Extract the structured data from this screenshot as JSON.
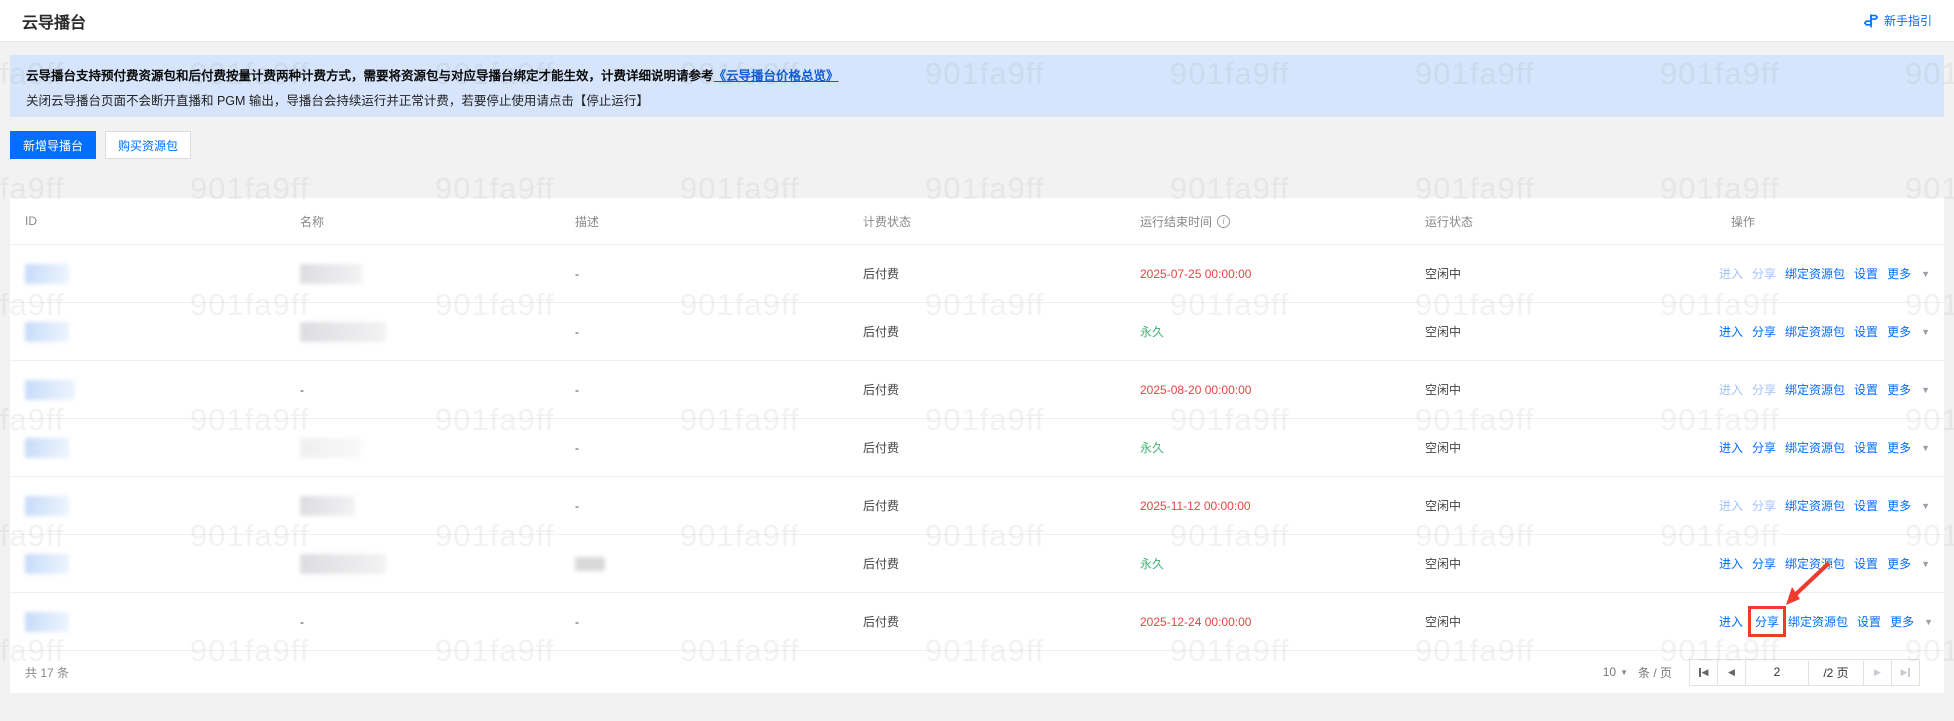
{
  "page": {
    "title": "云导播台"
  },
  "header": {
    "guide_label": "新手指引"
  },
  "banner": {
    "line1_prefix": "云导播台支持预付费资源包和后付费按量计费两种计费方式，需要将资源包与对应导播台绑定才能生效，计费详细说明请参考",
    "line1_link": "《云导播台价格总览》",
    "line2": "关闭云导播台页面不会断开直播和 PGM 输出，导播台会持续运行并正常计费，若要停止使用请点击【停止运行】"
  },
  "toolbar": {
    "create_label": "新增导播台",
    "buy_label": "购买资源包"
  },
  "table": {
    "columns": [
      "ID",
      "名称",
      "描述",
      "计费状态",
      "运行结束时间",
      "运行状态",
      "操作"
    ],
    "actions": {
      "enter": "进入",
      "share": "分享",
      "bind": "绑定资源包",
      "settings": "设置",
      "more": "更多"
    },
    "rows": [
      {
        "name": "",
        "desc": "-",
        "billing": "后付费",
        "end_time": "2025-07-25 00:00:00",
        "status": "空闲中"
      },
      {
        "name": "",
        "desc": "-",
        "billing": "后付费",
        "end_time": "永久",
        "status": "空闲中"
      },
      {
        "name": "-",
        "desc": "-",
        "billing": "后付费",
        "end_time": "2025-08-20 00:00:00",
        "status": "空闲中"
      },
      {
        "name": "",
        "desc": "-",
        "billing": "后付费",
        "end_time": "永久",
        "status": "空闲中"
      },
      {
        "name": "",
        "desc": "-",
        "billing": "后付费",
        "end_time": "2025-11-12 00:00:00",
        "status": "空闲中"
      },
      {
        "name": "",
        "desc": "",
        "billing": "后付费",
        "end_time": "永久",
        "status": "空闲中"
      },
      {
        "name": "-",
        "desc": "-",
        "billing": "后付费",
        "end_time": "2025-12-24 00:00:00",
        "status": "空闲中"
      }
    ]
  },
  "footer": {
    "total": "共 17 条",
    "page_size": "10",
    "per_page_unit": "条 / 页",
    "current_page": "2",
    "total_pages": "/2 页"
  },
  "icons": {
    "info": "i",
    "caret_down": "▼",
    "prev": "◀",
    "next": "▶"
  },
  "watermark": {
    "text": "901fa9ff"
  },
  "colors": {
    "accent": "#006eff",
    "expired_red": "#e54545",
    "permanent_green": "#3eb575",
    "annotation_red": "#ee3b2e",
    "banner_bg": "#d6e5fc"
  }
}
